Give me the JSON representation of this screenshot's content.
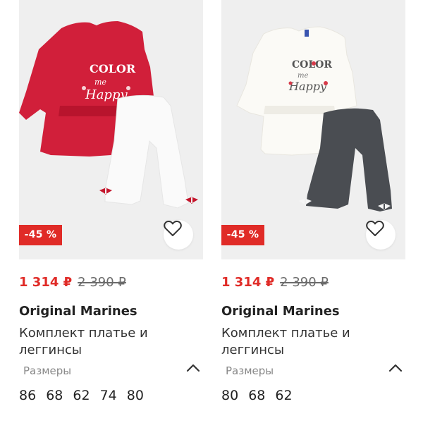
{
  "colors": {
    "sale": "#e02b27",
    "old_price": "#6b6b6b",
    "badge_bg": "#e02b27",
    "card_bg": "#efefef"
  },
  "products": [
    {
      "discount": "-45 %",
      "price_current": "1 314 ₽",
      "price_old": "2 390 ₽",
      "brand": "Original Marines",
      "title": "Комплект платье и леггинсы",
      "sizes_label": "Размеры",
      "sizes": [
        "86",
        "68",
        "62",
        "74",
        "80"
      ],
      "favorite_icon": "heart-outline-icon",
      "expand_icon": "chevron-up-icon"
    },
    {
      "discount": "-45 %",
      "price_current": "1 314 ₽",
      "price_old": "2 390 ₽",
      "brand": "Original Marines",
      "title": "Комплект платье и леггинсы",
      "sizes_label": "Размеры",
      "sizes": [
        "80",
        "68",
        "62"
      ],
      "favorite_icon": "heart-outline-icon",
      "expand_icon": "chevron-up-icon"
    }
  ]
}
